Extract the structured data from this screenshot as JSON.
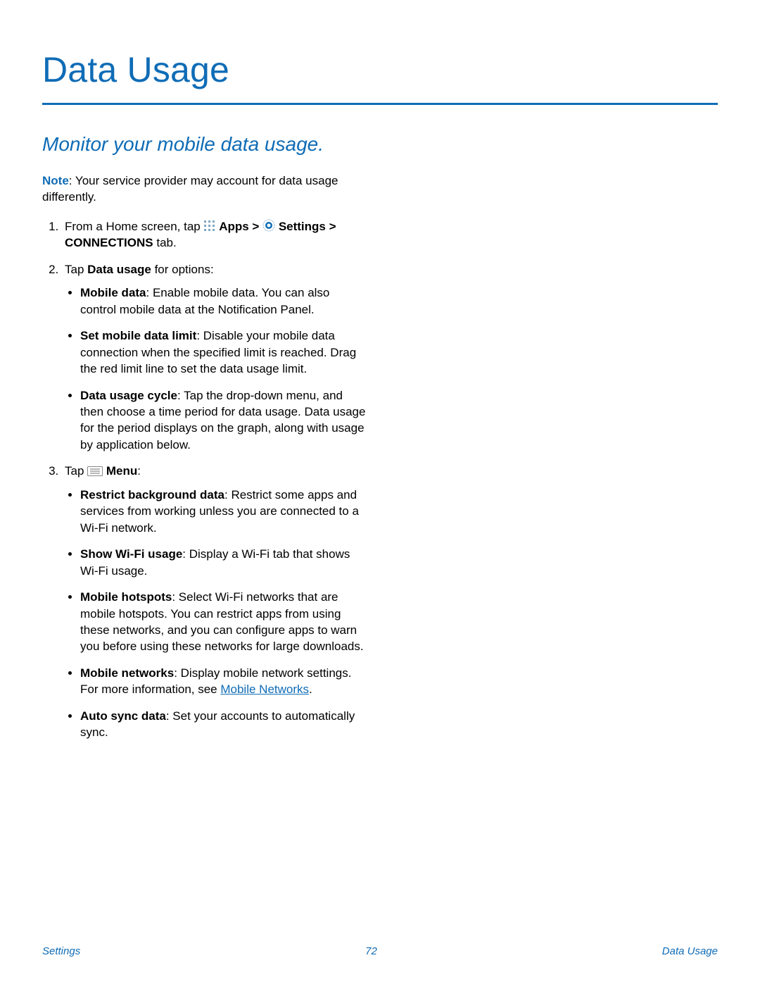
{
  "title": "Data Usage",
  "subtitle": "Monitor your mobile data usage.",
  "note": {
    "label": "Note",
    "text": ": Your service provider may account for data usage differently."
  },
  "steps": {
    "s1": {
      "pre": "From a Home screen, tap ",
      "apps": "Apps",
      "gt1": " > ",
      "settings": "Settings",
      "gt2": " > ",
      "conn": "CONNECTIONS",
      "tab": " tab."
    },
    "s2": {
      "pre": "Tap ",
      "du": "Data usage",
      "post": " for options:",
      "items": {
        "mobile_data": {
          "b": "Mobile data",
          "t": ": Enable mobile data. You can also control mobile data at the Notification Panel."
        },
        "set_limit": {
          "b": "Set mobile data limit",
          "t": ": Disable your mobile data connection when the specified limit is reached. Drag the red limit line to set the data usage limit."
        },
        "cycle": {
          "b": "Data usage cycle",
          "t": ": Tap the drop-down menu, and then choose a time period for data usage. Data usage for the period displays on the graph, along with usage by application below."
        }
      }
    },
    "s3": {
      "pre": "Tap ",
      "menu": "Menu",
      "post": ":",
      "items": {
        "restrict": {
          "b": "Restrict background data",
          "t": ": Restrict some apps and services from working unless you are connected to a Wi-Fi network."
        },
        "wifi": {
          "b": "Show Wi-Fi usage",
          "t": ": Display a Wi-Fi tab that shows Wi-Fi usage."
        },
        "hotspots": {
          "b": "Mobile hotspots",
          "t": ": Select Wi-Fi networks that are mobile hotspots. You can restrict apps from using these networks, and you can configure apps to warn you before using these networks for large downloads."
        },
        "networks": {
          "b": "Mobile networks",
          "t": ": Display mobile network settings. For more information, see ",
          "link": "Mobile Networks",
          "after": "."
        },
        "autosync": {
          "b": "Auto sync data",
          "t": ": Set your accounts to automatically sync."
        }
      }
    }
  },
  "footer": {
    "left": "Settings",
    "center": "72",
    "right": "Data Usage"
  }
}
